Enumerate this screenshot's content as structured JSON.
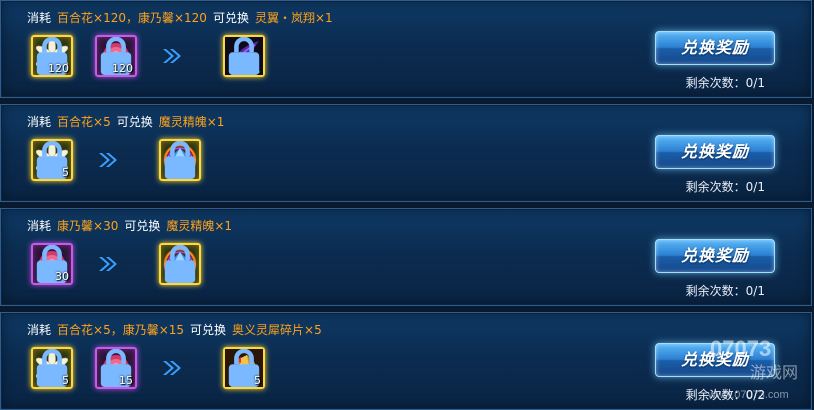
{
  "rows": [
    {
      "header": {
        "prefix": "消耗",
        "cost": "百合花×120，康乃馨×120",
        "mid": "可兑换",
        "reward": "灵翼・岚翔×1"
      },
      "items": [
        {
          "icon": "lily-icon",
          "count": "120"
        },
        {
          "icon": "carnation-icon",
          "count": "120"
        }
      ],
      "result": {
        "icon": "wing-icon",
        "count": ""
      },
      "button": "兑换奖励",
      "remaining": "剩余次数：0/1"
    },
    {
      "header": {
        "prefix": "消耗",
        "cost": "百合花×5",
        "mid": "可兑换",
        "reward": "魔灵精魄×1"
      },
      "items": [
        {
          "icon": "lily-icon",
          "count": "5"
        }
      ],
      "result": {
        "icon": "blue-crystal-icon",
        "count": ""
      },
      "button": "兑换奖励",
      "remaining": "剩余次数：0/1"
    },
    {
      "header": {
        "prefix": "消耗",
        "cost": "康乃馨×30",
        "mid": "可兑换",
        "reward": "魔灵精魄×1"
      },
      "items": [
        {
          "icon": "carnation-icon",
          "count": "30"
        }
      ],
      "result": {
        "icon": "blue-crystal-icon",
        "count": ""
      },
      "button": "兑换奖励",
      "remaining": "剩余次数：0/1"
    },
    {
      "header": {
        "prefix": "消耗",
        "cost": "百合花×5，康乃馨×15",
        "mid": "可兑换",
        "reward": "奥义灵犀碎片×5"
      },
      "items": [
        {
          "icon": "lily-icon",
          "count": "5"
        },
        {
          "icon": "carnation-icon",
          "count": "15"
        }
      ],
      "result": {
        "icon": "fragment-icon",
        "count": "5"
      },
      "button": "兑换奖励",
      "remaining": "剩余次数：0/2"
    }
  ],
  "watermark": {
    "brand": "07073",
    "sub": "游戏网",
    "url": "www.07073.com"
  },
  "colors": {
    "highlight": "#ffa21a",
    "gold_frame": "#ffd93a",
    "purple_frame": "#c85ae8",
    "button": "#2b7fd1"
  }
}
